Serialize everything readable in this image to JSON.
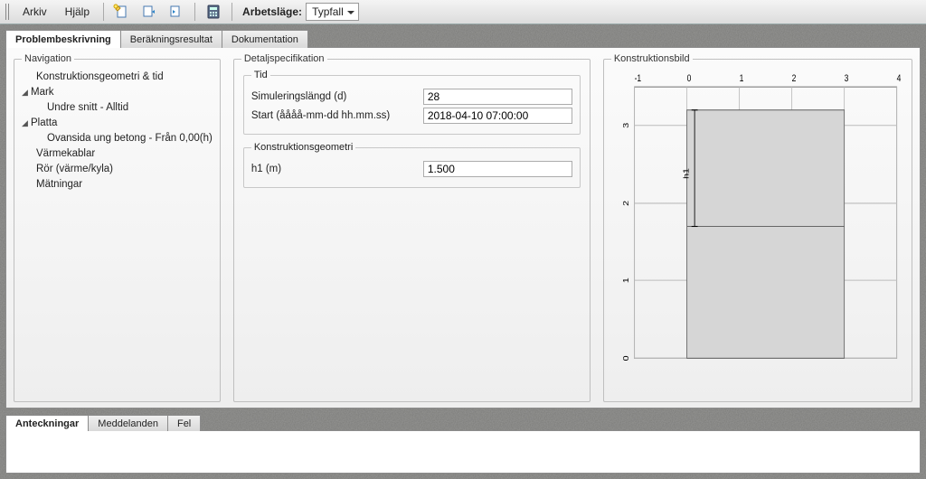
{
  "menu": {
    "arkiv": "Arkiv",
    "hjalp": "Hjälp"
  },
  "worklabel": "Arbetsläge:",
  "workmode": "Typfall",
  "top_tabs": {
    "problem": "Problembeskrivning",
    "result": "Beräkningsresultat",
    "doc": "Dokumentation"
  },
  "nav": {
    "legend": "Navigation",
    "items": {
      "geo": "Konstruktionsgeometri & tid",
      "mark": "Mark",
      "mark_child": "Undre snitt - Alltid",
      "platta": "Platta",
      "platta_child": "Ovansida ung betong - Från 0,00(h)",
      "varme": "Värmekablar",
      "ror": "Rör (värme/kyla)",
      "mat": "Mätningar"
    }
  },
  "detail": {
    "legend": "Detaljspecifikation",
    "tid_legend": "Tid",
    "simlen_lbl": "Simuleringslängd (d)",
    "simlen_val": "28",
    "start_lbl": "Start (åååå-mm-dd hh.mm.ss)",
    "start_val": "2018-04-10 07:00:00",
    "geo_legend": "Konstruktionsgeometri",
    "h1_lbl": "h1 (m)",
    "h1_val": "1.500"
  },
  "viz": {
    "legend": "Konstruktionsbild",
    "x_ticks": [
      "-1",
      "0",
      "1",
      "2",
      "3",
      "4"
    ],
    "y_ticks": [
      "0",
      "1",
      "2",
      "3"
    ],
    "h1_label": "h1"
  },
  "bottom_tabs": {
    "ant": "Anteckningar",
    "med": "Meddelanden",
    "fel": "Fel"
  },
  "chart_data": {
    "type": "diagram",
    "x_range": [
      -1,
      4
    ],
    "y_range": [
      0,
      3.5
    ],
    "slab": {
      "x": [
        0,
        3
      ],
      "y": [
        0,
        3.2
      ]
    },
    "h1_span": {
      "y0": 1.7,
      "y1": 3.2,
      "value": 1.5
    }
  }
}
